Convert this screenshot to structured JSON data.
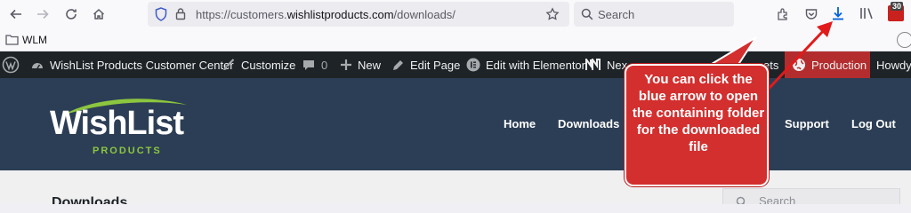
{
  "browser": {
    "url_prefix": "https://customers.",
    "url_domain": "wishlistproducts.com",
    "url_path": "/downloads/",
    "search_placeholder": "Search",
    "extension_badge": "30"
  },
  "bookmarks": [
    {
      "label": "WLM"
    }
  ],
  "admin_bar": {
    "site_name": "WishList Products Customer Center",
    "customize": "Customize",
    "comments_count": "0",
    "new": "New",
    "edit_page": "Edit Page",
    "edit_elementor": "Edit with Elementor",
    "next_partial": "Nex",
    "ets_partial": "ets",
    "production": "Production",
    "howdy": "Howdy,"
  },
  "site": {
    "logo_main": "WishList",
    "logo_sub": "PRODUCTS",
    "menu": [
      "Home",
      "Downloads",
      "Support",
      "Log Out"
    ]
  },
  "content": {
    "page_title": "Downloads",
    "sidebar_search": "Search"
  },
  "callout": {
    "text": "You can click the blue arrow to open the containing folder for the downloaded file",
    "color": "#d32f2f"
  },
  "colors": {
    "admin_bar": "#1d2327",
    "header": "#2c3e55",
    "accent_green": "#8cc63f",
    "download_blue": "#0060df",
    "production": "#b32d2e"
  }
}
